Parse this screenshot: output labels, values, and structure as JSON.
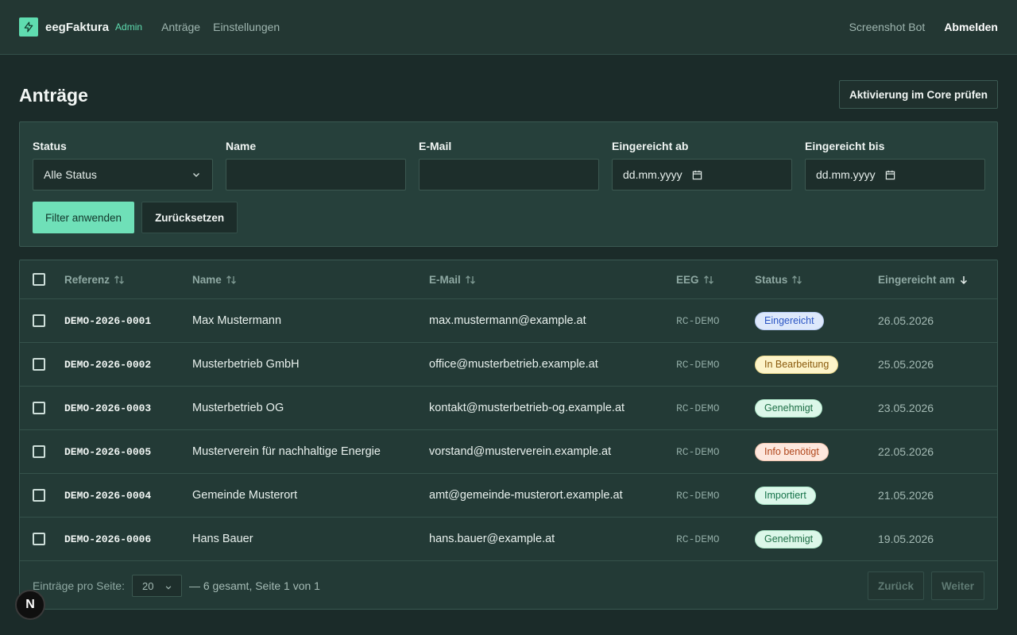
{
  "app": {
    "brand": "eegFaktura",
    "role": "Admin",
    "nav": [
      "Anträge",
      "Einstellungen"
    ],
    "user": "Screenshot Bot",
    "logout": "Abmelden"
  },
  "page": {
    "title": "Anträge",
    "check_button": "Aktivierung im Core prüfen"
  },
  "filters": {
    "status_label": "Status",
    "status_value": "Alle Status",
    "name_label": "Name",
    "name_value": "",
    "email_label": "E-Mail",
    "email_value": "",
    "from_label": "Eingereicht ab",
    "from_placeholder": "dd.mm.yyyy",
    "to_label": "Eingereicht bis",
    "to_placeholder": "dd.mm.yyyy",
    "apply": "Filter anwenden",
    "reset": "Zurücksetzen"
  },
  "table": {
    "columns": [
      "Referenz",
      "Name",
      "E-Mail",
      "EEG",
      "Status",
      "Eingereicht am"
    ],
    "rows": [
      {
        "ref": "DEMO-2026-0001",
        "name": "Max Mustermann",
        "email": "max.mustermann@example.at",
        "eeg": "RC-DEMO",
        "status": "Eingereicht",
        "date": "26.05.2026"
      },
      {
        "ref": "DEMO-2026-0002",
        "name": "Musterbetrieb GmbH",
        "email": "office@musterbetrieb.example.at",
        "eeg": "RC-DEMO",
        "status": "In Bearbeitung",
        "date": "25.05.2026"
      },
      {
        "ref": "DEMO-2026-0003",
        "name": "Musterbetrieb OG",
        "email": "kontakt@musterbetrieb-og.example.at",
        "eeg": "RC-DEMO",
        "status": "Genehmigt",
        "date": "23.05.2026"
      },
      {
        "ref": "DEMO-2026-0005",
        "name": "Musterverein für nachhaltige Energie",
        "email": "vorstand@musterverein.example.at",
        "eeg": "RC-DEMO",
        "status": "Info benötigt",
        "date": "22.05.2026"
      },
      {
        "ref": "DEMO-2026-0004",
        "name": "Gemeinde Musterort",
        "email": "amt@gemeinde-musterort.example.at",
        "eeg": "RC-DEMO",
        "status": "Importiert",
        "date": "21.05.2026"
      },
      {
        "ref": "DEMO-2026-0006",
        "name": "Hans Bauer",
        "email": "hans.bauer@example.at",
        "eeg": "RC-DEMO",
        "status": "Genehmigt",
        "date": "19.05.2026"
      }
    ]
  },
  "status_colors": {
    "Eingereicht": {
      "bg": "#dde8fb",
      "fg": "#2b55c4",
      "border": "#b9cdf5"
    },
    "In Bearbeitung": {
      "bg": "#fdf4c9",
      "fg": "#8a5a0c",
      "border": "#efdc8e"
    },
    "Genehmigt": {
      "bg": "#dcf7e9",
      "fg": "#1d6e45",
      "border": "#b2ebcd"
    },
    "Info benötigt": {
      "bg": "#fde7dd",
      "fg": "#b0451a",
      "border": "#f7c7b1"
    },
    "Importiert": {
      "bg": "#dcf7ea",
      "fg": "#16734a",
      "border": "#b0ecce"
    }
  },
  "footer": {
    "per_page_label": "Einträge pro Seite:",
    "per_page_value": "20",
    "summary": "— 6 gesamt, Seite 1 von 1",
    "prev": "Zurück",
    "next": "Weiter"
  },
  "dev_badge": "N",
  "icons": {
    "logo": "lightning-icon",
    "select": "chevron-down-icon",
    "date": "calendar-icon",
    "sort": "sort-icon",
    "sort_active": "arrow-down-icon"
  }
}
